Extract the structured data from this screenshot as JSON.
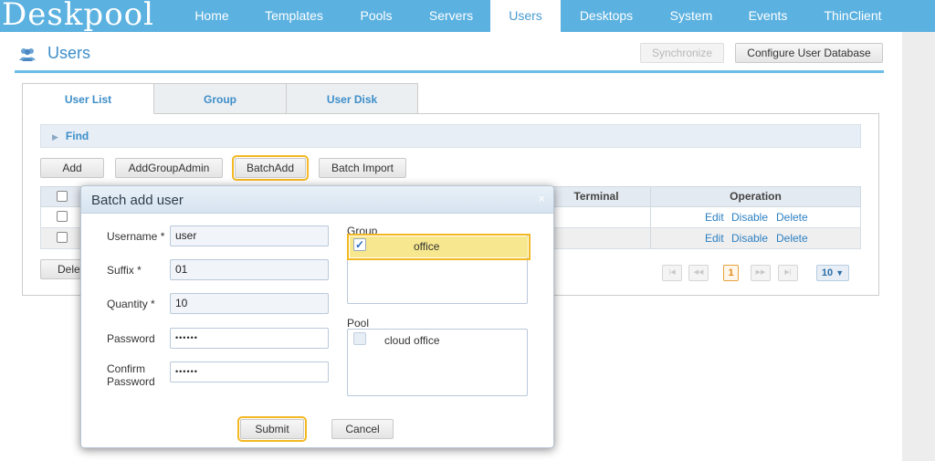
{
  "app": {
    "logo": "Deskpool",
    "nav": [
      {
        "label": "Home"
      },
      {
        "label": "Templates"
      },
      {
        "label": "Pools"
      },
      {
        "label": "Servers"
      },
      {
        "label": "Users",
        "active": true
      },
      {
        "label": "Desktops"
      },
      {
        "label": "System"
      },
      {
        "label": "Events"
      },
      {
        "label": "ThinClient"
      }
    ]
  },
  "page": {
    "title": "Users",
    "icon": "users-icon",
    "synchronize": "Synchronize",
    "configure_db": "Configure User Database"
  },
  "tabs": [
    {
      "label": "User List",
      "active": true
    },
    {
      "label": "Group"
    },
    {
      "label": "User Disk"
    }
  ],
  "find": {
    "label": "Find"
  },
  "toolbar": {
    "add": "Add",
    "add_group_admin": "AddGroupAdmin",
    "batch_add": "BatchAdd",
    "batch_import": "Batch Import",
    "delete_partial": "Delet"
  },
  "table": {
    "headers": {
      "terminal": "Terminal",
      "operation": "Operation"
    },
    "row_actions": {
      "edit": "Edit",
      "disable": "Disable",
      "delete": "Delete"
    }
  },
  "pager": {
    "current": "1",
    "page_size": "10"
  },
  "modal": {
    "title": "Batch add user",
    "close": "×",
    "username_label": "Username",
    "username_value": "user",
    "suffix_label": "Suffix",
    "suffix_value": "01",
    "quantity_label": "Quantity",
    "quantity_value": "10",
    "password_label": "Password",
    "password_value": "••••••",
    "confirm_label_1": "Confirm",
    "confirm_label_2": "Password",
    "confirm_value": "••••••",
    "required_mark": "*",
    "group_label": "Group",
    "group_option": "office",
    "pool_label": "Pool",
    "pool_option": "cloud office",
    "submit": "Submit",
    "cancel": "Cancel"
  },
  "colors": {
    "nav": "#5bb1e0",
    "accent": "#3d8ec9",
    "highlight": "#f3b822"
  }
}
